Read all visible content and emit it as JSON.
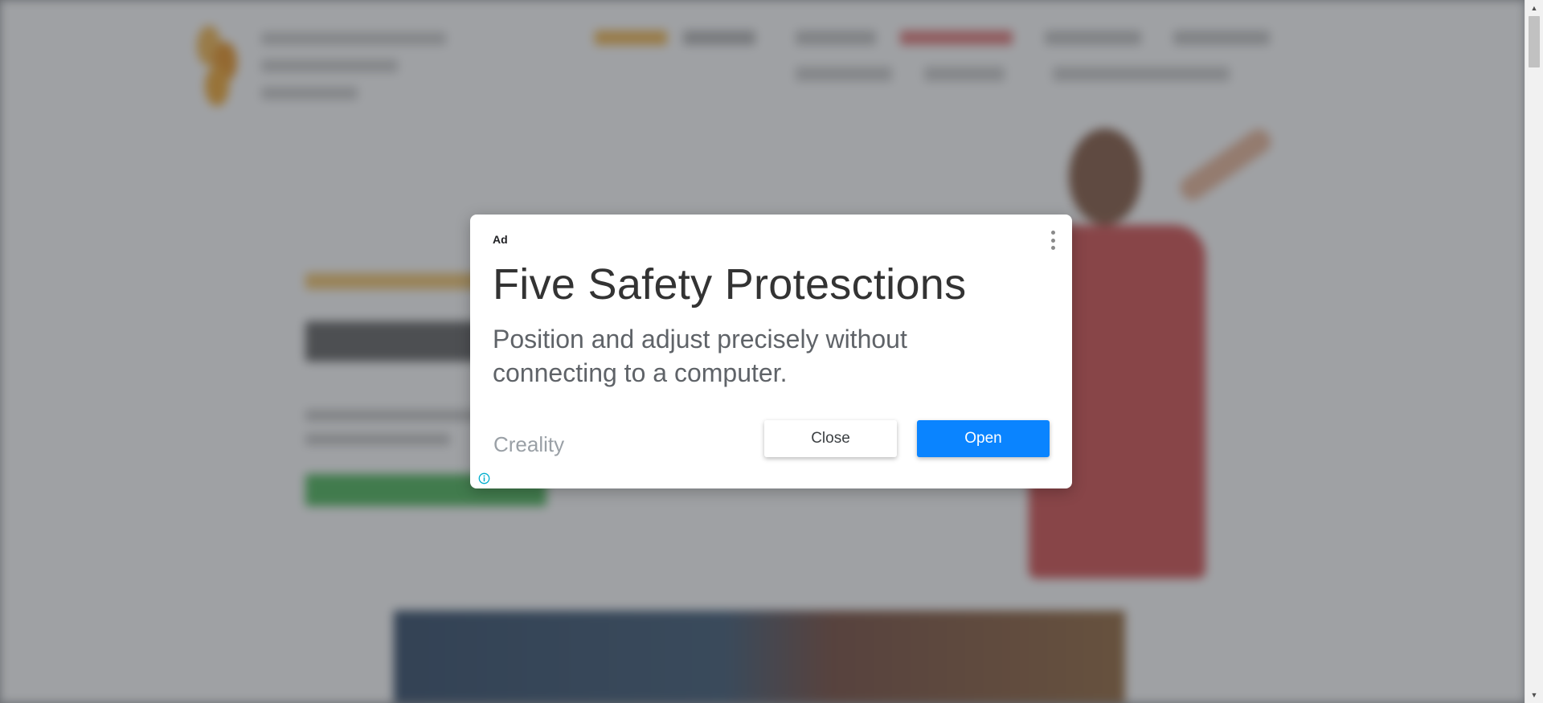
{
  "ad": {
    "label": "Ad",
    "title": "Five Safety Protesctions",
    "body": "Position and adjust precisely without connecting to a computer.",
    "brand": "Creality",
    "close_label": "Close",
    "open_label": "Open",
    "menu_icon": "more-vert-icon",
    "info_icon": "info-icon"
  },
  "colors": {
    "open_button": "#0a84ff",
    "info_icon": "#00aecd",
    "overlay": "#464a50"
  }
}
